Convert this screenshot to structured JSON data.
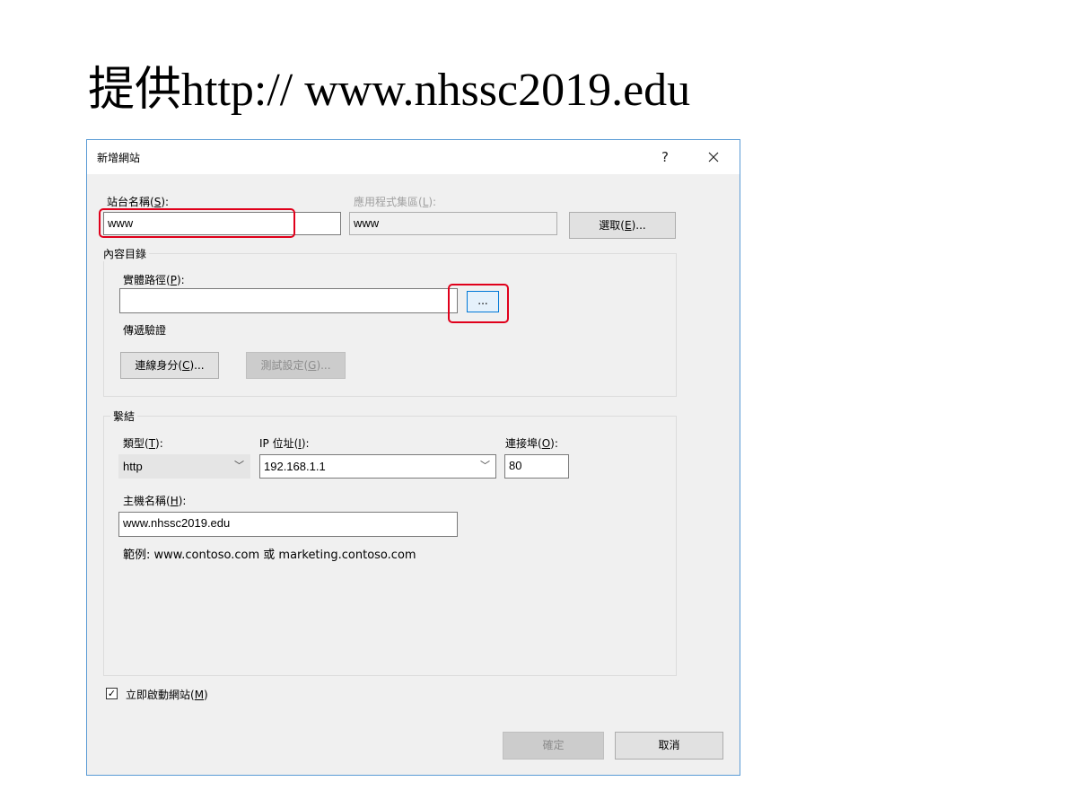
{
  "slide_title": "提供http:// www.nhssc2019.edu",
  "dialog": {
    "title": "新增網站",
    "help_label": "?",
    "close_icon": "close-icon",
    "site_name": {
      "label_prefix": "站台名稱(",
      "mnemonic": "S",
      "label_suffix": "):",
      "value": "www"
    },
    "app_pool": {
      "label_prefix": "應用程式集區(",
      "mnemonic": "L",
      "label_suffix": "):",
      "value": "www"
    },
    "select_button": {
      "prefix": "選取(",
      "mnemonic": "E",
      "suffix": ")..."
    },
    "content_directory": {
      "legend": "內容目錄",
      "physical_path": {
        "label_prefix": "實體路徑(",
        "mnemonic": "P",
        "label_suffix": "):",
        "value": ""
      },
      "browse_button": "...",
      "pass_through": "傳遞驗證",
      "connect_as": {
        "prefix": "連線身分(",
        "mnemonic": "C",
        "suffix": ")..."
      },
      "test_settings": {
        "prefix": "測試設定(",
        "mnemonic": "G",
        "suffix": ")..."
      }
    },
    "binding": {
      "legend": "繫結",
      "type": {
        "label_prefix": "類型(",
        "mnemonic": "T",
        "label_suffix": "):",
        "value": "http"
      },
      "ip": {
        "label_prefix": "IP 位址(",
        "mnemonic": "I",
        "label_suffix": "):",
        "value": "192.168.1.1"
      },
      "port": {
        "label_prefix": "連接埠(",
        "mnemonic": "O",
        "label_suffix": "):",
        "value": "80"
      },
      "host": {
        "label_prefix": "主機名稱(",
        "mnemonic": "H",
        "label_suffix": "):",
        "value": "www.nhssc2019.edu"
      },
      "example": "範例: www.contoso.com 或 marketing.contoso.com"
    },
    "start_immediately": {
      "checked": true,
      "check_glyph": "✓",
      "prefix": "立即啟動網站(",
      "mnemonic": "M",
      "suffix": ")"
    },
    "ok_button": "確定",
    "cancel_button": "取消",
    "highlight_color": "#e0001b",
    "accent_color": "#0078d7"
  }
}
